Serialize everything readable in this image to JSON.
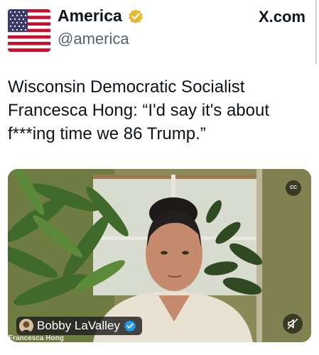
{
  "header": {
    "display_name": "America",
    "handle": "@america",
    "brand": "X.com"
  },
  "tweet": {
    "lines": [
      "Wisconsin Democratic Socialist",
      "Francesca Hong: “I'd say it's about",
      "f***ing time we 86 Trump.”"
    ]
  },
  "video": {
    "cc_label": "CC",
    "credit_name": "Bobby LaValley",
    "lower_third": "Francesca Hong"
  },
  "icons": {
    "avatar": "us-flag-icon",
    "verified_gold": "verified-gold-badge-icon",
    "verified_blue": "verified-blue-badge-icon",
    "cc": "closed-captions-icon",
    "mute": "muted-speaker-icon"
  },
  "colors": {
    "text": "#0f1419",
    "secondary_text": "#536471",
    "gold_badge": "#e8b830",
    "blue_badge": "#1d9bf0"
  }
}
